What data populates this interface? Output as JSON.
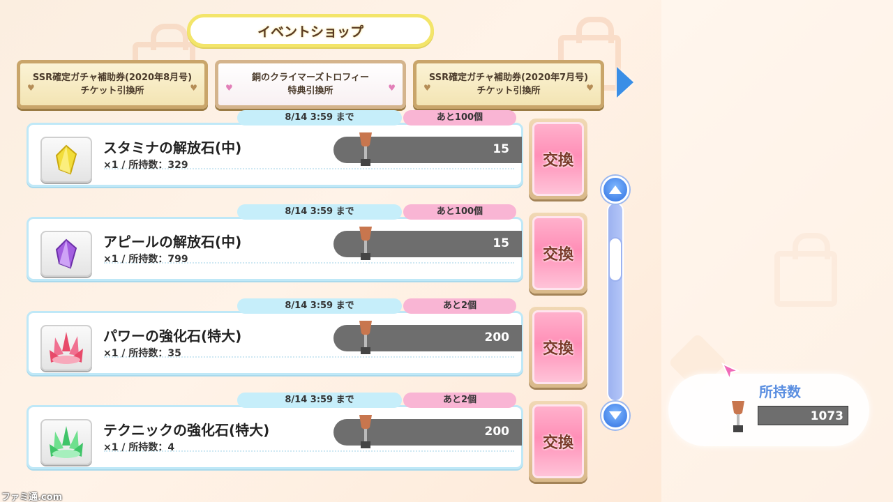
{
  "header": {
    "title": "イベントショップ"
  },
  "tabs": [
    {
      "line1": "SSR確定ガチャ補助券(2020年8月号)",
      "line2": "チケット引換所",
      "active": false
    },
    {
      "line1": "銅のクライマーズトロフィー",
      "line2": "特典引換所",
      "active": true
    },
    {
      "line1": "SSR確定ガチャ補助券(2020年7月号)",
      "line2": "チケット引換所",
      "active": false
    }
  ],
  "items": [
    {
      "deadline": "8/14 3:59 まで",
      "remaining": "あと100個",
      "name": "スタミナの解放石(中)",
      "qty": "×1 / 所持数：329",
      "cost": "15",
      "icon": "yellow-crystal-icon",
      "color": "#f2dd3a"
    },
    {
      "deadline": "8/14 3:59 まで",
      "remaining": "あと100個",
      "name": "アピールの解放石(中)",
      "qty": "×1 / 所持数：799",
      "cost": "15",
      "icon": "purple-crystal-icon",
      "color": "#a35ee0"
    },
    {
      "deadline": "8/14 3:59 まで",
      "remaining": "あと2個",
      "name": "パワーの強化石(特大)",
      "qty": "×1 / 所持数：35",
      "cost": "200",
      "icon": "red-crystal-cluster-icon",
      "color": "#e84a6a"
    },
    {
      "deadline": "8/14 3:59 まで",
      "remaining": "あと2個",
      "name": "テクニックの強化石(特大)",
      "qty": "×1 / 所持数：4",
      "cost": "200",
      "icon": "green-crystal-cluster-icon",
      "color": "#3fc468"
    }
  ],
  "exchange_label": "交換",
  "owned": {
    "label": "所持数",
    "value": "1073"
  },
  "watermark": "ファミ通.com",
  "colors": {
    "accent_pink": "#ff8fb7",
    "scroll_blue": "#2f6fe0",
    "title_border": "#f3e56a"
  }
}
